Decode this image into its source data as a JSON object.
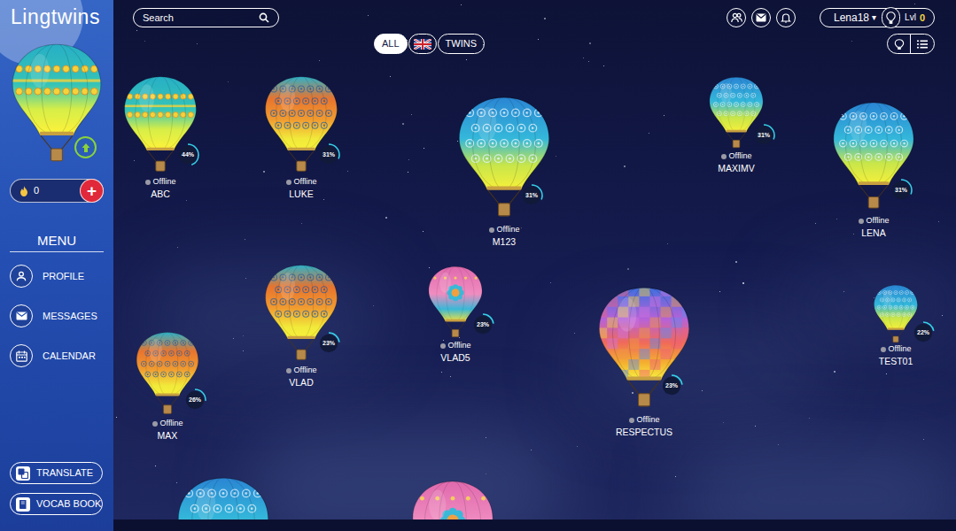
{
  "app": {
    "logo": "Lingtwins"
  },
  "my_balloon": {
    "kind": "teal-sun"
  },
  "sidebar": {
    "points": "0",
    "add_button": "+",
    "menu_title": "MENU",
    "items": [
      {
        "label": "PROFILE"
      },
      {
        "label": "MESSAGES"
      },
      {
        "label": "CALENDAR"
      }
    ],
    "tools": [
      {
        "label": "TRANSLATE"
      },
      {
        "label": "VOCAB BOOK"
      }
    ]
  },
  "search": {
    "placeholder": "Search"
  },
  "filters": [
    {
      "kind": "text",
      "label": "ALL",
      "selected": true
    },
    {
      "kind": "flag",
      "selected": false
    },
    {
      "kind": "text",
      "label": "TWINS",
      "selected": false
    }
  ],
  "user_menu": {
    "username": "Lena18",
    "dropdown": "▾",
    "level_label": "Lvl",
    "level_value": "0"
  },
  "balloons": [
    {
      "name": "ABC",
      "status": "Offline",
      "online": false,
      "percent": "44%",
      "level": 0.44,
      "kind": "teal-sun"
    },
    {
      "name": "LUKE",
      "status": "Offline",
      "online": false,
      "percent": "31%",
      "level": 0.31,
      "kind": "orange-swirl"
    },
    {
      "name": "M123",
      "status": "Offline",
      "online": false,
      "percent": "31%",
      "level": 0.31,
      "kind": "teal-swirl"
    },
    {
      "name": "MAXIMV",
      "status": "Offline",
      "online": false,
      "percent": "31%",
      "level": 0.31,
      "kind": "teal-swirl"
    },
    {
      "name": "LENA",
      "status": "Offline",
      "online": false,
      "percent": "31%",
      "level": 0.31,
      "kind": "teal-swirl"
    },
    {
      "name": "VLAD",
      "status": "Offline",
      "online": false,
      "percent": "23%",
      "level": 0.23,
      "kind": "orange-swirl"
    },
    {
      "name": "VLAD5",
      "status": "Offline",
      "online": false,
      "percent": "23%",
      "level": 0.23,
      "kind": "pink-flower"
    },
    {
      "name": "RESPECTUS",
      "status": "Offline",
      "online": false,
      "percent": "23%",
      "level": 0.23,
      "kind": "checker"
    },
    {
      "name": "TEST01",
      "status": "Offline",
      "online": false,
      "percent": "22%",
      "level": 0.22,
      "kind": "teal-swirl"
    },
    {
      "name": "MAX",
      "status": "Offline",
      "online": false,
      "percent": "26%",
      "level": 0.26,
      "kind": "orange-swirl"
    }
  ],
  "partial_balloons": [
    {
      "kind": "teal-swirl"
    },
    {
      "kind": "pink-flower"
    }
  ]
}
